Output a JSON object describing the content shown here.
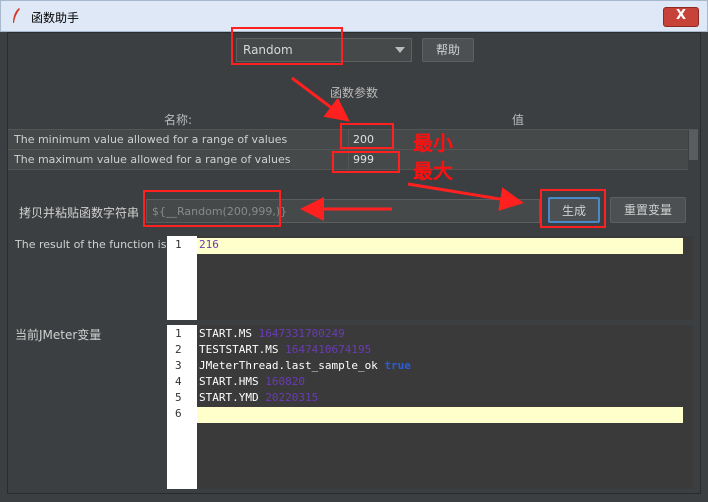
{
  "window": {
    "title": "函数助手",
    "close_label": "X"
  },
  "function_select": {
    "value": "Random"
  },
  "help_button": "帮助",
  "params_section_title": "函数参数",
  "params_table": {
    "headers": [
      "名称:",
      "值"
    ],
    "rows": [
      {
        "name": "The minimum value allowed for a range of values",
        "value": "200"
      },
      {
        "name": "The maximum value allowed for a range of values",
        "value": "999"
      }
    ]
  },
  "copy_label": "拷贝并粘贴函数字符串",
  "function_string": "${__Random(200,999,)}",
  "generate_button": "生成",
  "reset_button": "重置变量",
  "result_label": "The result of the function is",
  "result_lines": [
    {
      "num": "1",
      "text": "216"
    }
  ],
  "vars_label": "当前JMeter变量",
  "vars_lines": [
    {
      "num": "1",
      "key": "START.MS",
      "value": "1647331700249"
    },
    {
      "num": "2",
      "key": "TESTSTART.MS",
      "value": "1647410674195"
    },
    {
      "num": "3",
      "key": "JMeterThread.last_sample_ok",
      "value": "true"
    },
    {
      "num": "4",
      "key": "START.HMS",
      "value": "160820"
    },
    {
      "num": "5",
      "key": "START.YMD",
      "value": "20220315"
    },
    {
      "num": "6",
      "key": "",
      "value": ""
    }
  ],
  "annotations": {
    "min": "最小",
    "max": "最大"
  },
  "colors": {
    "annotation": "#ff2020",
    "accent_button_border": "#4a88c7"
  }
}
